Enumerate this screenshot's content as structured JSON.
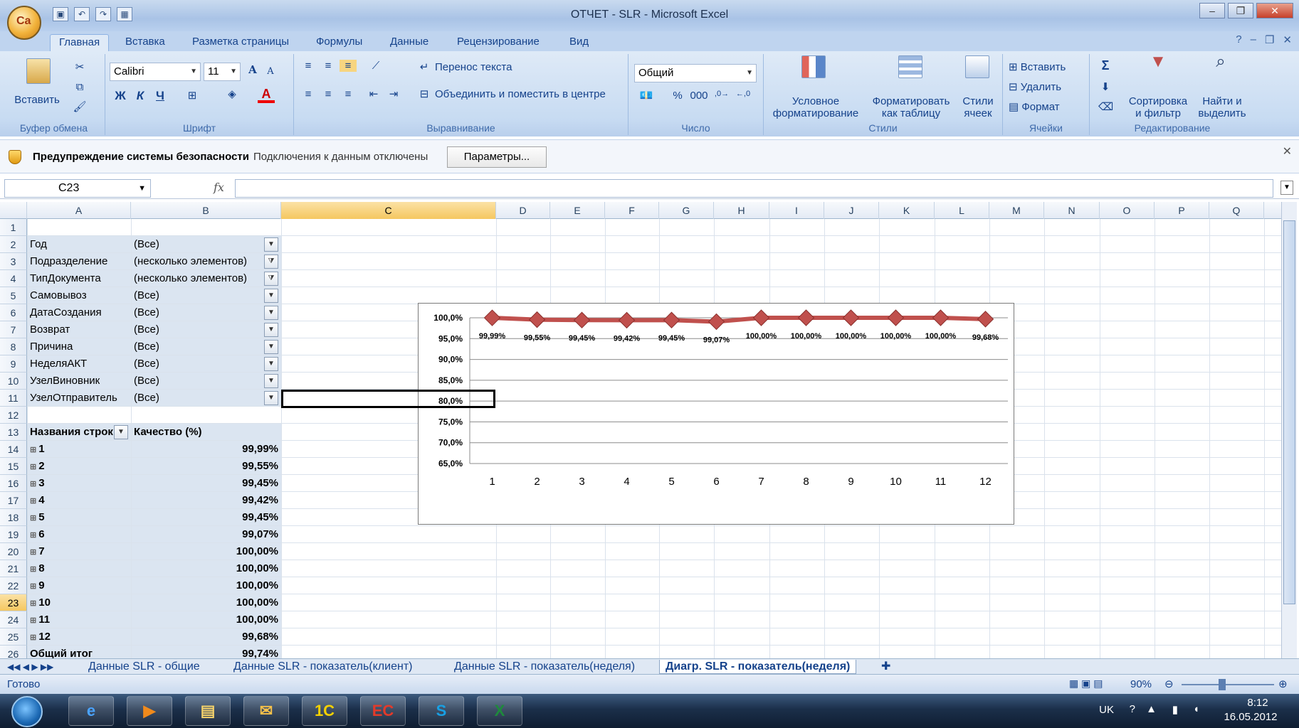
{
  "window": {
    "title": "ОТЧЕТ - SLR - Microsoft Excel",
    "office_button_glyph": "Ca"
  },
  "ribbon_tabs": [
    "Главная",
    "Вставка",
    "Разметка страницы",
    "Формулы",
    "Данные",
    "Рецензирование",
    "Вид"
  ],
  "ribbon": {
    "clipboard": {
      "paste_label": "Вставить",
      "group_label": "Буфер обмена"
    },
    "font": {
      "font_name": "Calibri",
      "font_size": "11",
      "bold": "Ж",
      "italic": "К",
      "underline": "Ч",
      "grow": "A",
      "shrink": "A",
      "font_color_glyph": "A",
      "group_label": "Шрифт"
    },
    "alignment": {
      "wrap_text": "Перенос текста",
      "merge_center": "Объединить и поместить в центре",
      "group_label": "Выравнивание"
    },
    "number": {
      "format": "Общий",
      "percent": "%",
      "thousands": "000",
      "group_label": "Число"
    },
    "styles": {
      "conditional": [
        "Условное",
        "форматирование"
      ],
      "as_table": [
        "Форматировать",
        "как таблицу"
      ],
      "cell_styles": [
        "Стили",
        "ячеек"
      ],
      "group_label": "Стили"
    },
    "cells": {
      "insert": "Вставить",
      "delete": "Удалить",
      "format": "Формат",
      "group_label": "Ячейки"
    },
    "editing": {
      "sigma": "Σ",
      "sort": [
        "Сортировка",
        "и фильтр"
      ],
      "find": [
        "Найти и",
        "выделить"
      ],
      "group_label": "Редактирование"
    }
  },
  "security_bar": {
    "title": "Предупреждение системы безопасности",
    "message": "Подключения к данным отключены",
    "button": "Параметры..."
  },
  "formula_bar": {
    "name_box": "C23",
    "fx": "fx",
    "formula": ""
  },
  "columns": [
    "A",
    "B",
    "C",
    "D",
    "E",
    "F",
    "G",
    "H",
    "I",
    "J",
    "K",
    "L",
    "M",
    "N",
    "O",
    "P",
    "Q"
  ],
  "selected_column": "C",
  "selected_row": 23,
  "row_numbers": [
    "1",
    "2",
    "3",
    "4",
    "5",
    "6",
    "7",
    "8",
    "9",
    "10",
    "11",
    "12",
    "13",
    "14",
    "15",
    "16",
    "17",
    "18",
    "19",
    "20",
    "21",
    "22",
    "23",
    "24",
    "25",
    "26"
  ],
  "pivot_filters": [
    {
      "field": "Год",
      "value": "(Все)",
      "filtered": false
    },
    {
      "field": "Подразделение",
      "value": "(несколько элементов)",
      "filtered": true
    },
    {
      "field": "ТипДокумента",
      "value": "(несколько элементов)",
      "filtered": true
    },
    {
      "field": "Самовывоз",
      "value": "(Все)",
      "filtered": false
    },
    {
      "field": "ДатаСоздания",
      "value": "(Все)",
      "filtered": false
    },
    {
      "field": "Возврат",
      "value": "(Все)",
      "filtered": false
    },
    {
      "field": "Причина",
      "value": "(Все)",
      "filtered": false
    },
    {
      "field": "НеделяАКТ",
      "value": "(Все)",
      "filtered": false
    },
    {
      "field": "УзелВиновник",
      "value": "(Все)",
      "filtered": false
    },
    {
      "field": "УзелОтправитель",
      "value": "(Все)",
      "filtered": false
    }
  ],
  "pivot_table": {
    "row_header": "Названия строк",
    "value_header": "Качество (%)",
    "rows": [
      {
        "label": "1",
        "value": "99,99%"
      },
      {
        "label": "2",
        "value": "99,55%"
      },
      {
        "label": "3",
        "value": "99,45%"
      },
      {
        "label": "4",
        "value": "99,42%"
      },
      {
        "label": "5",
        "value": "99,45%"
      },
      {
        "label": "6",
        "value": "99,07%"
      },
      {
        "label": "7",
        "value": "100,00%"
      },
      {
        "label": "8",
        "value": "100,00%"
      },
      {
        "label": "9",
        "value": "100,00%"
      },
      {
        "label": "10",
        "value": "100,00%"
      },
      {
        "label": "11",
        "value": "100,00%"
      },
      {
        "label": "12",
        "value": "99,68%"
      }
    ],
    "total_label": "Общий итог",
    "total_value": "99,74%"
  },
  "chart_data": {
    "type": "line",
    "title": "",
    "xlabel": "",
    "ylabel": "",
    "categories": [
      "1",
      "2",
      "3",
      "4",
      "5",
      "6",
      "7",
      "8",
      "9",
      "10",
      "11",
      "12"
    ],
    "series": [
      {
        "values": [
          99.99,
          99.55,
          99.45,
          99.42,
          99.45,
          99.07,
          100.0,
          100.0,
          100.0,
          100.0,
          100.0,
          99.68
        ],
        "color": "#c0504d"
      }
    ],
    "data_labels": [
      "99,99%",
      "99,55%",
      "99,45%",
      "99,42%",
      "99,45%",
      "99,07%",
      "100,00%",
      "100,00%",
      "100,00%",
      "100,00%",
      "100,00%",
      "99,68%"
    ],
    "ylim": [
      65,
      100
    ],
    "yticks": [
      "100,0%",
      "95,0%",
      "90,0%",
      "85,0%",
      "80,0%",
      "75,0%",
      "70,0%",
      "65,0%"
    ],
    "grid": true,
    "legend": "none",
    "marker": "diamond"
  },
  "sheet_tabs": [
    {
      "label": "Данные SLR - общие",
      "active": false
    },
    {
      "label": "Данные SLR - показатель(клиент)",
      "active": false
    },
    {
      "label": "Данные SLR - показатель(неделя)",
      "active": false
    },
    {
      "label": "Диагр. SLR - показатель(неделя)",
      "active": true
    }
  ],
  "status": {
    "ready": "Готово",
    "zoom": "90%"
  },
  "taskbar": {
    "apps": [
      "ie-icon",
      "media-player-icon",
      "explorer-icon",
      "outlook-icon",
      "1c-icon",
      "reader-icon",
      "skype-icon",
      "excel-icon"
    ],
    "app_glyphs": [
      "e",
      "▶",
      "▤",
      "✉",
      "1С",
      "EC",
      "S",
      "X"
    ],
    "lang": "UK",
    "time": "8:12",
    "date": "16.05.2012"
  }
}
